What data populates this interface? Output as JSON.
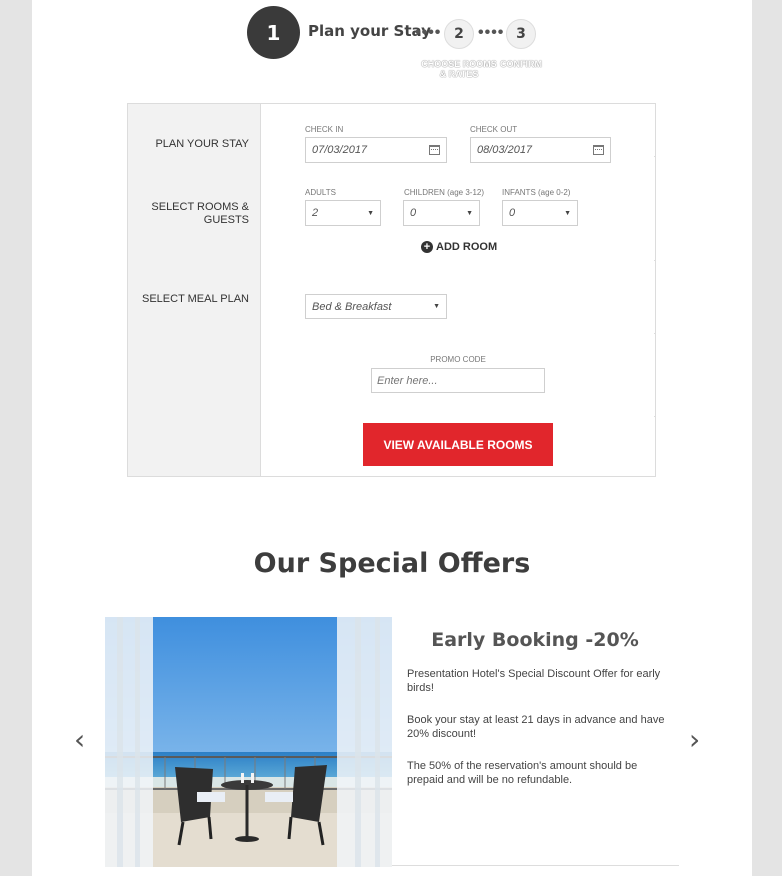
{
  "steps": {
    "step1_number": "1",
    "step1_label": "Plan your Stay",
    "step2_number": "2",
    "step2_sub": "CHOOSE ROOMS & RATES",
    "step3_number": "3",
    "step3_sub": "CONFIRM"
  },
  "form": {
    "plan_label": "PLAN YOUR STAY",
    "rooms_label_line1": "SELECT ROOMS &",
    "rooms_label_line2": "GUESTS",
    "meal_label": "SELECT MEAL PLAN",
    "checkin_label": "CHECK IN",
    "checkin_value": "07/03/2017",
    "checkout_label": "CHECK OUT",
    "checkout_value": "08/03/2017",
    "adults_label": "ADULTS",
    "adults_value": "2",
    "children_label": "CHILDREN (age 3-12)",
    "children_value": "0",
    "infants_label": "INFANTS (age 0-2)",
    "infants_value": "0",
    "add_room": "ADD ROOM",
    "meal_value": "Bed & Breakfast",
    "promo_label": "PROMO CODE",
    "promo_placeholder": "Enter here...",
    "submit": "VIEW AVAILABLE ROOMS"
  },
  "offers": {
    "title": "Our Special Offers",
    "prev_arrow": "‹",
    "next_arrow": "›",
    "heading": "Early Booking -20%",
    "p1": "Presentation Hotel's Special Discount Offer for early birds!",
    "p2": "Book your stay at least 21 days in advance and have 20% discount!",
    "p3": "The 50% of the reservation's amount should be prepaid and will be no refundable."
  },
  "icons": {
    "calendar": "calendar-icon",
    "plus": "plus-circle-icon",
    "caret": "caret-down-icon",
    "arrows": "chevron-icons"
  },
  "colors": {
    "accent": "#e1262c",
    "step_active": "#3a3a3a",
    "page_bg": "#e4e4e4"
  }
}
